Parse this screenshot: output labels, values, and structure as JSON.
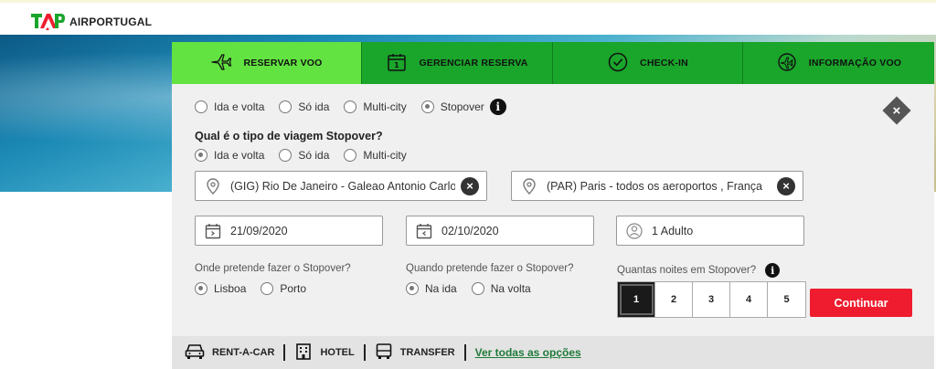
{
  "brand": {
    "name": "AIRPORTUGAL",
    "logo_text": "TAP"
  },
  "tabs": [
    {
      "label": "RESERVAR VOO",
      "icon": "plane-icon",
      "active": true
    },
    {
      "label": "GERENCIAR RESERVA",
      "icon": "calendar-icon",
      "active": false
    },
    {
      "label": "CHECK-IN",
      "icon": "check-circle-icon",
      "active": false
    },
    {
      "label": "INFORMAÇÃO VOO",
      "icon": "flight-info-icon",
      "active": false
    }
  ],
  "trip_type": {
    "options": [
      "Ida e volta",
      "Só ida",
      "Multi-city",
      "Stopover"
    ],
    "selected": "Stopover",
    "info": "i"
  },
  "stopover_trip": {
    "question": "Qual é o tipo de viagem Stopover?",
    "options": [
      "Ida e volta",
      "Só ida",
      "Multi-city"
    ],
    "selected": "Ida e volta"
  },
  "origin": {
    "value": "(GIG) Rio De Janeiro - Galeao Antonio Carlos Jobim",
    "icon": "location-pin-icon"
  },
  "destination": {
    "value": "(PAR) Paris - todos os aeroportos , França",
    "icon": "location-pin-icon"
  },
  "depart_date": {
    "value": "21/09/2020",
    "icon": "calendar-depart-icon"
  },
  "return_date": {
    "value": "02/10/2020",
    "icon": "calendar-return-icon"
  },
  "passengers": {
    "value": "1 Adulto",
    "icon": "passenger-icon"
  },
  "stopover_where": {
    "question": "Onde pretende fazer o Stopover?",
    "options": [
      "Lisboa",
      "Porto"
    ],
    "selected": "Lisboa"
  },
  "stopover_when": {
    "question": "Quando pretende fazer o Stopover?",
    "options": [
      "Na ida",
      "Na volta"
    ],
    "selected": "Na ida"
  },
  "stopover_nights": {
    "question": "Quantas noites em Stopover?",
    "options": [
      "1",
      "2",
      "3",
      "4",
      "5"
    ],
    "selected": "1"
  },
  "continue_label": "Continuar",
  "close_label": "×",
  "clear_label": "×",
  "extras": {
    "items": [
      {
        "label": "RENT-A-CAR",
        "icon": "car-icon"
      },
      {
        "label": "HOTEL",
        "icon": "hotel-icon"
      },
      {
        "label": "TRANSFER",
        "icon": "bus-icon"
      }
    ],
    "all_link": "Ver todas as opções"
  },
  "colors": {
    "tab_green": "#1aa52b",
    "tab_active": "#63e341",
    "continue_red": "#ee1c2e"
  }
}
